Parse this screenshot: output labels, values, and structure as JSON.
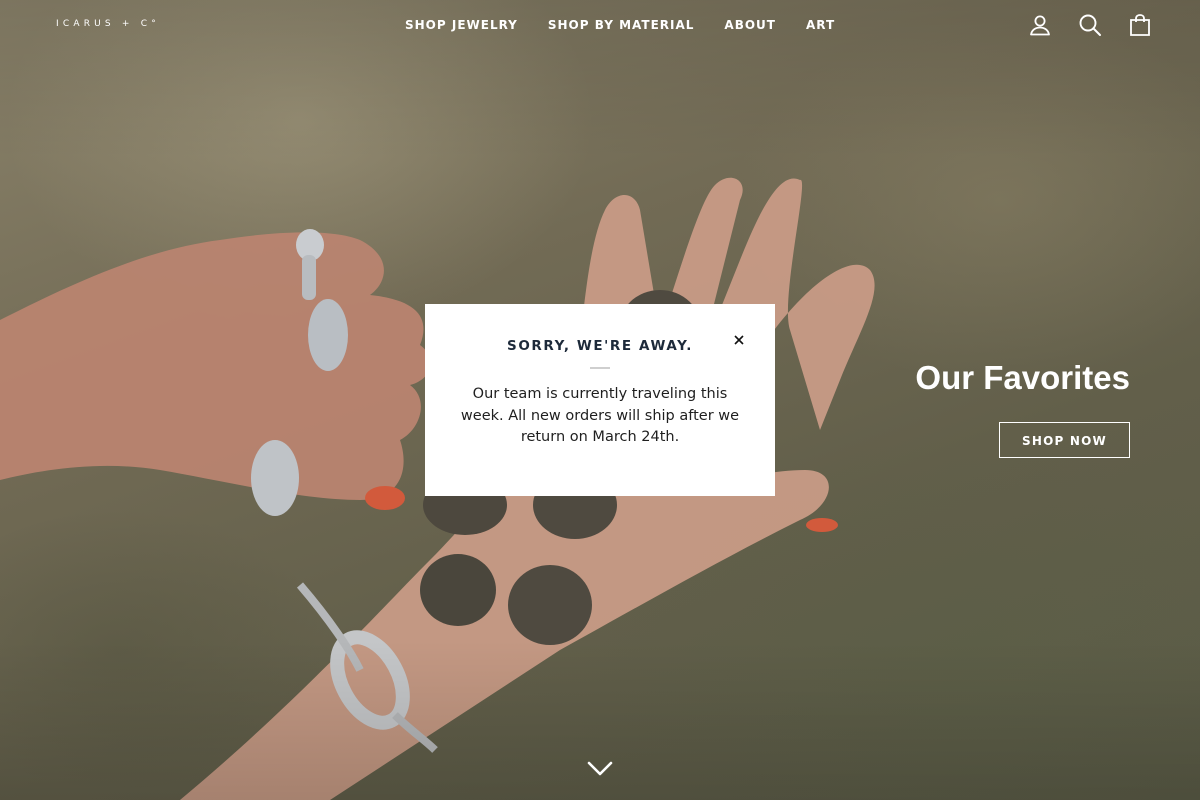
{
  "header": {
    "logo_text": "ICARUS + C°",
    "nav": [
      {
        "label": "SHOP JEWELRY"
      },
      {
        "label": "SHOP BY MATERIAL"
      },
      {
        "label": "ABOUT"
      },
      {
        "label": "ART"
      }
    ],
    "icons": [
      "account-icon",
      "search-icon",
      "cart-icon"
    ]
  },
  "hero": {
    "promo_title": "Our Favorites",
    "promo_button_label": "SHOP NOW",
    "scroll_icon": "chevron-down-icon"
  },
  "modal": {
    "title": "SORRY, WE'RE AWAY.",
    "body": "Our team is currently traveling this week. All new orders will ship after we return on March 24th.",
    "close_icon": "close-icon"
  },
  "colors": {
    "header_text": "#ffffff",
    "modal_title": "#1d2a3a",
    "modal_background": "#ffffff"
  }
}
